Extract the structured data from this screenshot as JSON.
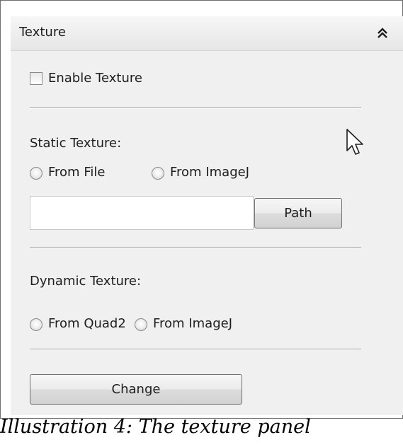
{
  "panel": {
    "title": "Texture",
    "collapse_icon": "double-chevron-up-icon"
  },
  "enable_texture": {
    "label": "Enable Texture",
    "checked": false
  },
  "static_texture": {
    "label": "Static Texture:",
    "options": [
      {
        "label": "From File",
        "selected": false
      },
      {
        "label": "From ImageJ",
        "selected": false
      }
    ],
    "path_value": "",
    "path_button_label": "Path"
  },
  "dynamic_texture": {
    "label": "Dynamic Texture:",
    "options": [
      {
        "label": "From Quad2",
        "selected": false
      },
      {
        "label": "From ImageJ",
        "selected": false
      }
    ]
  },
  "change_button_label": "Change",
  "cursor": "mouse-pointer-icon",
  "caption": "Illustration 4: The texture panel"
}
